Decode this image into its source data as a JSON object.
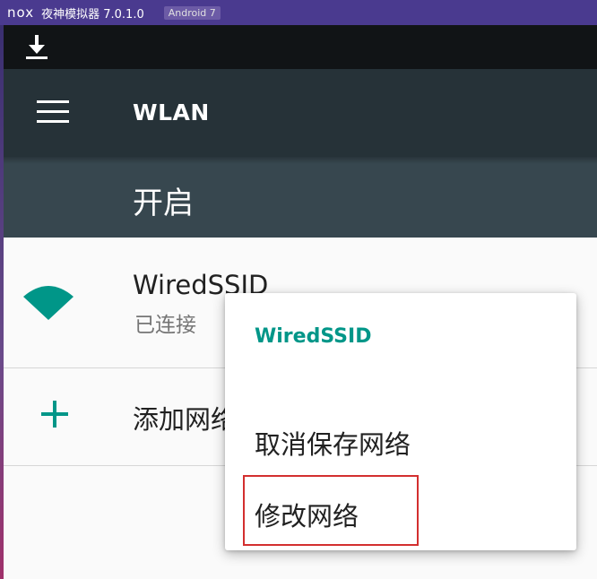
{
  "window": {
    "logo_text": "nox",
    "app_title": "夜神模拟器 7.0.1.0",
    "android_badge": "Android 7"
  },
  "statusbar": {
    "icons": [
      "download-icon"
    ]
  },
  "appbar": {
    "menu_icon": "hamburger-icon",
    "title": "WLAN"
  },
  "switchbar": {
    "label": "开启"
  },
  "network_list": {
    "items": [
      {
        "ssid": "WiredSSID",
        "status": "已连接",
        "icon": "wifi-signal-icon"
      }
    ],
    "add_network": {
      "label": "添加网络",
      "icon": "plus-icon"
    }
  },
  "context_menu": {
    "title": "WiredSSID",
    "items": [
      {
        "label": "取消保存网络"
      },
      {
        "label": "修改网络",
        "highlighted": true
      }
    ]
  },
  "colors": {
    "titlebar": "#4a3a8f",
    "appbar": "#263238",
    "switchbar": "#37474f",
    "accent": "#009688",
    "highlight": "#d32f2f"
  }
}
